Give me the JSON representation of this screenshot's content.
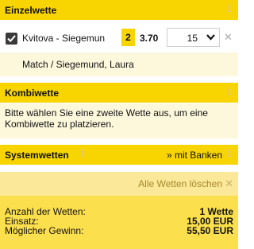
{
  "single_bet": {
    "title": "Einzelwette",
    "info_icon": "info-icon",
    "checkbox_checked": true,
    "match_short": "Kvitova - Siegemun",
    "tip": "2",
    "odds": "3.70",
    "stake": "15",
    "remove_icon": "close-icon",
    "match_full": "Match / Siegemund, Laura"
  },
  "combi_bet": {
    "title": "Kombiwette",
    "info_icon": "info-icon",
    "hint": "Bitte wählen Sie eine zweite Wette aus, um eine Kombiwette zu platzieren."
  },
  "system_bet": {
    "title": "Systemwetten",
    "banken_link": "» mit Banken",
    "info_icon": "info-icon"
  },
  "actions": {
    "delete_all": "Alle Wetten löschen",
    "delete_icon": "close-icon"
  },
  "summary": {
    "count_label": "Anzahl der Wetten:",
    "count_value": "1 Wette",
    "stake_label": "Einsatz:",
    "stake_value": "15,00 EUR",
    "win_label": "Möglicher Gewinn:",
    "win_value": "55,50 EUR"
  },
  "colors": {
    "header_yellow": "#f8d400",
    "light_cream": "#fdf7dc",
    "summary_yellow": "#fcdf4c"
  }
}
